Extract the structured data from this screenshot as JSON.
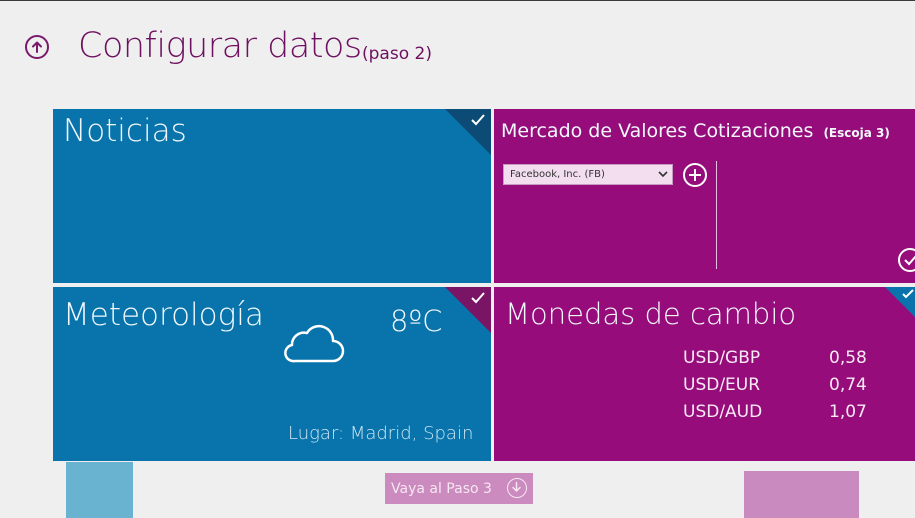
{
  "header": {
    "title": "Configurar datos",
    "step": "(paso 2)"
  },
  "tiles": {
    "news": {
      "title": "Noticias"
    },
    "stocks": {
      "title": "Mercado de Valores Cotizaciones",
      "hint": "(Escoja 3)",
      "selected_stock": "Facebook, Inc. (FB)"
    },
    "weather": {
      "title": "Meteorología",
      "temperature": "8ºC",
      "location": "Lugar: Madrid, Spain",
      "icon": "cloud-icon"
    },
    "currency": {
      "title": "Monedas de cambio",
      "rates": [
        {
          "pair": "USD/GBP",
          "value": "0,58"
        },
        {
          "pair": "USD/EUR",
          "value": "0,74"
        },
        {
          "pair": "USD/AUD",
          "value": "1,07"
        }
      ]
    }
  },
  "footer": {
    "next_label": "Vaya al Paso 3"
  },
  "colors": {
    "accent": "#6e1060",
    "tile_blue": "#0874ab",
    "tile_purple": "#960c7b",
    "background": "#efefef"
  }
}
